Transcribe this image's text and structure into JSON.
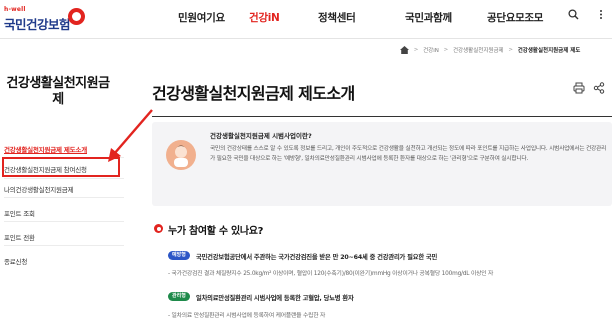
{
  "header": {
    "logo_small": "h-well",
    "logo_main": "국민건강보험",
    "nav": [
      "민원여기요",
      "건강iN",
      "정책센터",
      "국민과함께",
      "공단요모조모"
    ],
    "active_index": 1,
    "search_icon": "search-icon",
    "menu_icon": "menu-icon"
  },
  "breadcrumb": {
    "items": [
      "건강iN",
      "건강생활실천지원금제"
    ],
    "current": "건강생활실천지원금제 제도"
  },
  "sidebar": {
    "title": "건강생활실천지원금제",
    "items": [
      {
        "label": "건강생활실천지원금제 제도소개",
        "active": true
      },
      {
        "label": "건강생활실천지원금제 참여신청",
        "active": false
      },
      {
        "label": "나의건강생활실천지원금제",
        "active": false
      },
      {
        "label": "포인트 조회",
        "active": false
      },
      {
        "label": "포인트 전환",
        "active": false
      },
      {
        "label": "종료신청",
        "active": false
      }
    ]
  },
  "main": {
    "title": "건강생활실천지원금제 제도소개",
    "tools": [
      "print-icon",
      "share-icon"
    ],
    "intro": {
      "heading": "건강생활실천지원금제 시범사업이란?",
      "text": "국민의 건강상태를 스스로 알 수 있도록 정보를 드리고, 개인이 주도적으로 건강생활을 실천하고 개선되는 정도에 따라 포인트를 지급하는 사업입니다. 시범사업에서는 건강관리가 필요한 국민을 대상으로 하는 '예방형', 일차의료만성질환관리 시범사업에 등록한 환자를 대상으로 하는 '관리형'으로 구분하여 실시합니다."
    },
    "section_title": "누가 참여할 수 있나요?",
    "items": [
      {
        "badge": "예방형",
        "badge_color": "#2c56c6",
        "title": "국민건강보험공단에서 주관하는 국가건강검진을 받은 만 20~64세 중 건강관리가 필요한 국민",
        "desc": "- 국가건강검진 결과 체질량지수 25.0kg/m² 이상이며, 혈압이 120(수축기)/80(이완기)mmHg 이상이거나 공복혈당 100mg/dL 이상인 자"
      },
      {
        "badge": "관리형",
        "badge_color": "#1e8a4a",
        "title": "일차의료만성질환관리 시범사업에 등록한 고혈압, 당뇨병 환자",
        "desc": "- 일차의료 만성질환관리 시범사업에 등록하여 케어플랜을 수립한 자"
      }
    ]
  },
  "colors": {
    "brand_red": "#e2241f",
    "brand_blue": "#1f3a8a"
  }
}
